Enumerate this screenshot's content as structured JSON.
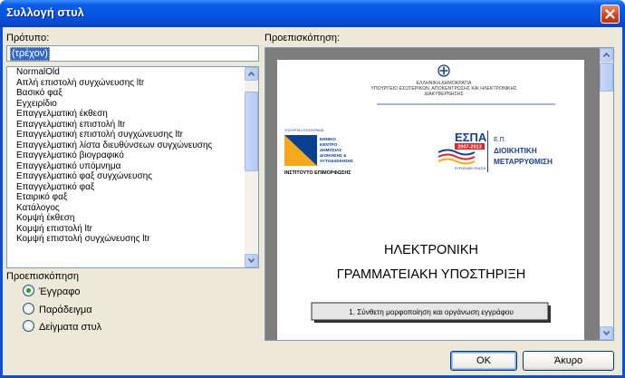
{
  "window": {
    "title": "Συλλογή στυλ"
  },
  "template": {
    "label": "Πρότυπο:",
    "current_value": "(τρέχον)",
    "items": [
      "NormalOld",
      "Απλή επιστολή συγχώνευσης ltr",
      "Βασικό φαξ",
      "Εγχειρίδιο",
      "Επαγγελματική έκθεση",
      "Επαγγελματική επιστολή ltr",
      "Επαγγελματική επιστολή συγχώνευσης ltr",
      "Επαγγελματική λίστα διευθύνσεων συγχώνευσης",
      "Επαγγελματικό βιογραφικό",
      "Επαγγελματικό υπόμνημα",
      "Επαγγελματικό φαξ συγχώνευσης",
      "Επαγγελματικό φαξ",
      "Εταιρικό φαξ",
      "Κατάλογος",
      "Κομψή έκθεση",
      "Κομψή επιστολή ltr",
      "Κομψή επιστολή συγχώνευσης ltr"
    ]
  },
  "preview_options": {
    "label": "Προεπισκόπηση",
    "options": [
      "Έγγραφο",
      "Παράδειγμα",
      "Δείγματα στυλ"
    ],
    "selected": "Έγγραφο"
  },
  "preview": {
    "label": "Προεπισκόπηση:",
    "doc": {
      "header_lines": [
        "ΕΛΛΗΝΙΚΗ ΔΗΜΟΚΡΑΤΙΑ",
        "ΥΠΟΥΡΓΕΙΟ ΕΣΩΤΕΡΙΚΩΝ, ΑΠΟΚΕΝΤΡΩΣΗΣ ΚΑΙ ΗΛΕΚΤΡΟΝΙΚΗΣ",
        "ΔΙΑΚΥΒΕΡΝΗΣΗΣ"
      ],
      "logo_left": {
        "small_text": "ΥΠΟΥΡΓΕΙΟ ΕΣΩΤΕΡΙΚΩΝ",
        "lines": [
          "ΕΘΝΙΚΟ",
          "ΚΕΝΤΡΟ",
          "ΔΗΜΟΣΙΑΣ",
          "ΔΙΟΙΚΗΣΗΣ &",
          "ΑΥΤΟΔΙΟΙΚΗΣΗΣ"
        ],
        "caption": "ΙΝΣΤΙΤΟΥΤΟ ΕΠΙΜΟΡΦΩΣΗΣ"
      },
      "logo_right": {
        "espa": "ΕΣΠΑ",
        "years": "2007-2013",
        "espa_sub": "ΕΥΡΩΠΑΪΚΗ ΕΝΩΣΗ",
        "ep": "Ε.Π.",
        "program_lines": [
          "ΔΙΟΙΚΗΤΙΚΗ",
          "ΜΕΤΑΡΡΥΘΜΙΣΗ"
        ]
      },
      "title_line1": "ΗΛΕΚΤΡΟΝΙΚΗ",
      "title_line2": "ΓΡΑΜΜΑΤΕΙΑΚΗ ΥΠΟΣΤΗΡΙΞΗ",
      "subtitle_box": "1. Σύνθετη μορφοποίηση και οργάνωση εγγράφου"
    }
  },
  "buttons": {
    "ok": "OK",
    "cancel": "Άκυρο"
  },
  "colors": {
    "title_bar": "#0554e3",
    "dialog_bg": "#ece9d8",
    "selection": "#316ac5",
    "radio_dot": "#21a121"
  }
}
